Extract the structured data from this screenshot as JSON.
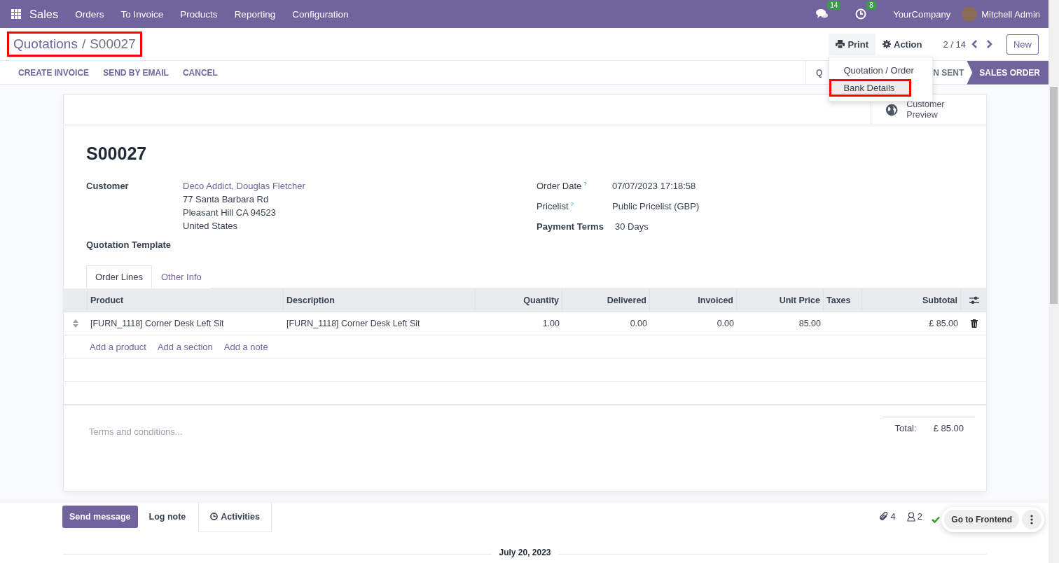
{
  "navbar": {
    "app": "Sales",
    "menus": [
      "Orders",
      "To Invoice",
      "Products",
      "Reporting",
      "Configuration"
    ],
    "messages_count": "14",
    "activities_count": "8",
    "company": "YourCompany",
    "user": "Mitchell Admin"
  },
  "control_panel": {
    "breadcrumb": {
      "parent": "Quotations",
      "separator": "/",
      "current": "S00027",
      "highlighted": true
    },
    "print": "Print",
    "action": "Action",
    "pager": "2 / 14",
    "new_button": "New"
  },
  "print_menu": [
    {
      "label": "Quotation / Order",
      "highlighted": false
    },
    {
      "label": "Bank Details",
      "highlighted": true
    }
  ],
  "action_buttons": [
    "CREATE INVOICE",
    "SEND BY EMAIL",
    "CANCEL"
  ],
  "status_stages": [
    {
      "label": "Q",
      "selected": false
    },
    {
      "label": "N SENT",
      "selected": false
    },
    {
      "label": "SALES ORDER",
      "selected": true
    }
  ],
  "sheet": {
    "smart_button": "Customer Preview",
    "title": "S00027",
    "left_fields": [
      {
        "label": "Customer",
        "lines": [
          "Deco Addict, Douglas Fletcher",
          "77 Santa Barbara Rd",
          "Pleasant Hill CA 94523",
          "United States"
        ]
      },
      {
        "label": "Quotation Template"
      }
    ],
    "right_fields": [
      {
        "label": "Order Date",
        "help": "?",
        "value": "07/07/2023 17:18:58"
      },
      {
        "label": "Pricelist",
        "help": "?",
        "value": "Public Pricelist (GBP)"
      },
      {
        "label": "Payment Terms",
        "value": "30 Days"
      }
    ],
    "tabs": [
      {
        "label": "Order Lines",
        "selected": true
      },
      {
        "label": "Other Info",
        "selected": false
      }
    ],
    "table": {
      "columns": [
        "Product",
        "Description",
        "Quantity",
        "Delivered",
        "Invoiced",
        "Unit Price",
        "Taxes",
        "Subtotal"
      ],
      "rows": [
        [
          "[FURN_1118] Corner Desk Left Sit",
          "[FURN_1118] Corner Desk Left Sit",
          "1.00",
          "0.00",
          "0.00",
          "85.00",
          "",
          "£ 85.00"
        ]
      ],
      "add_links": [
        "Add a product",
        "Add a section",
        "Add a note"
      ]
    },
    "terms_placeholder": "Terms and conditions...",
    "total_label": "Total:",
    "total_value": "£ 85.00"
  },
  "chatter": {
    "buttons": [
      {
        "label": "Send message",
        "selected": true
      },
      {
        "label": "Log note",
        "selected": false
      },
      {
        "label": "Activities",
        "selected": false
      }
    ],
    "attachments": "4",
    "followers": "2",
    "go_to_frontend": "Go to Frontend",
    "date": "July 20, 2023"
  }
}
